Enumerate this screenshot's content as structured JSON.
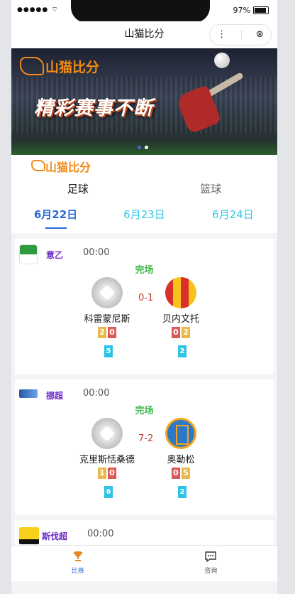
{
  "status": {
    "signal": "●●●●●",
    "battery": "97%"
  },
  "nav": {
    "title": "山猫比分",
    "more": "⋮",
    "close": "⊗"
  },
  "banner": {
    "brand": "山猫比分",
    "slogan": "精彩赛事不断"
  },
  "brand_text": "山猫比分",
  "tabs": [
    "足球",
    "篮球"
  ],
  "dates": [
    "6月22日",
    "6月23日",
    "6月24日"
  ],
  "matches": [
    {
      "league": "意乙",
      "time": "00:00",
      "status": "完场",
      "score": "0-1",
      "home": {
        "name": "科雷蒙尼斯",
        "yellow": "2",
        "red": "0",
        "corners": "5"
      },
      "away": {
        "name": "贝内文托",
        "red": "0",
        "yellow": "2",
        "corners": "2"
      }
    },
    {
      "league": "挪超",
      "time": "00:00",
      "status": "完场",
      "score": "7-2",
      "home": {
        "name": "克里斯恬桑德",
        "yellow": "1",
        "red": "0",
        "corners": "6"
      },
      "away": {
        "name": "奥勒松",
        "red": "0",
        "yellow": "5",
        "corners": "2"
      }
    },
    {
      "league": "斯伐超",
      "time": "00:00"
    }
  ],
  "bottom": {
    "match": "比赛",
    "consult": "咨询"
  },
  "colors": {
    "accent": "#2a6ad6",
    "brand": "#f28c14",
    "league": "#6a2bc9",
    "finished": "#3fb84c"
  }
}
